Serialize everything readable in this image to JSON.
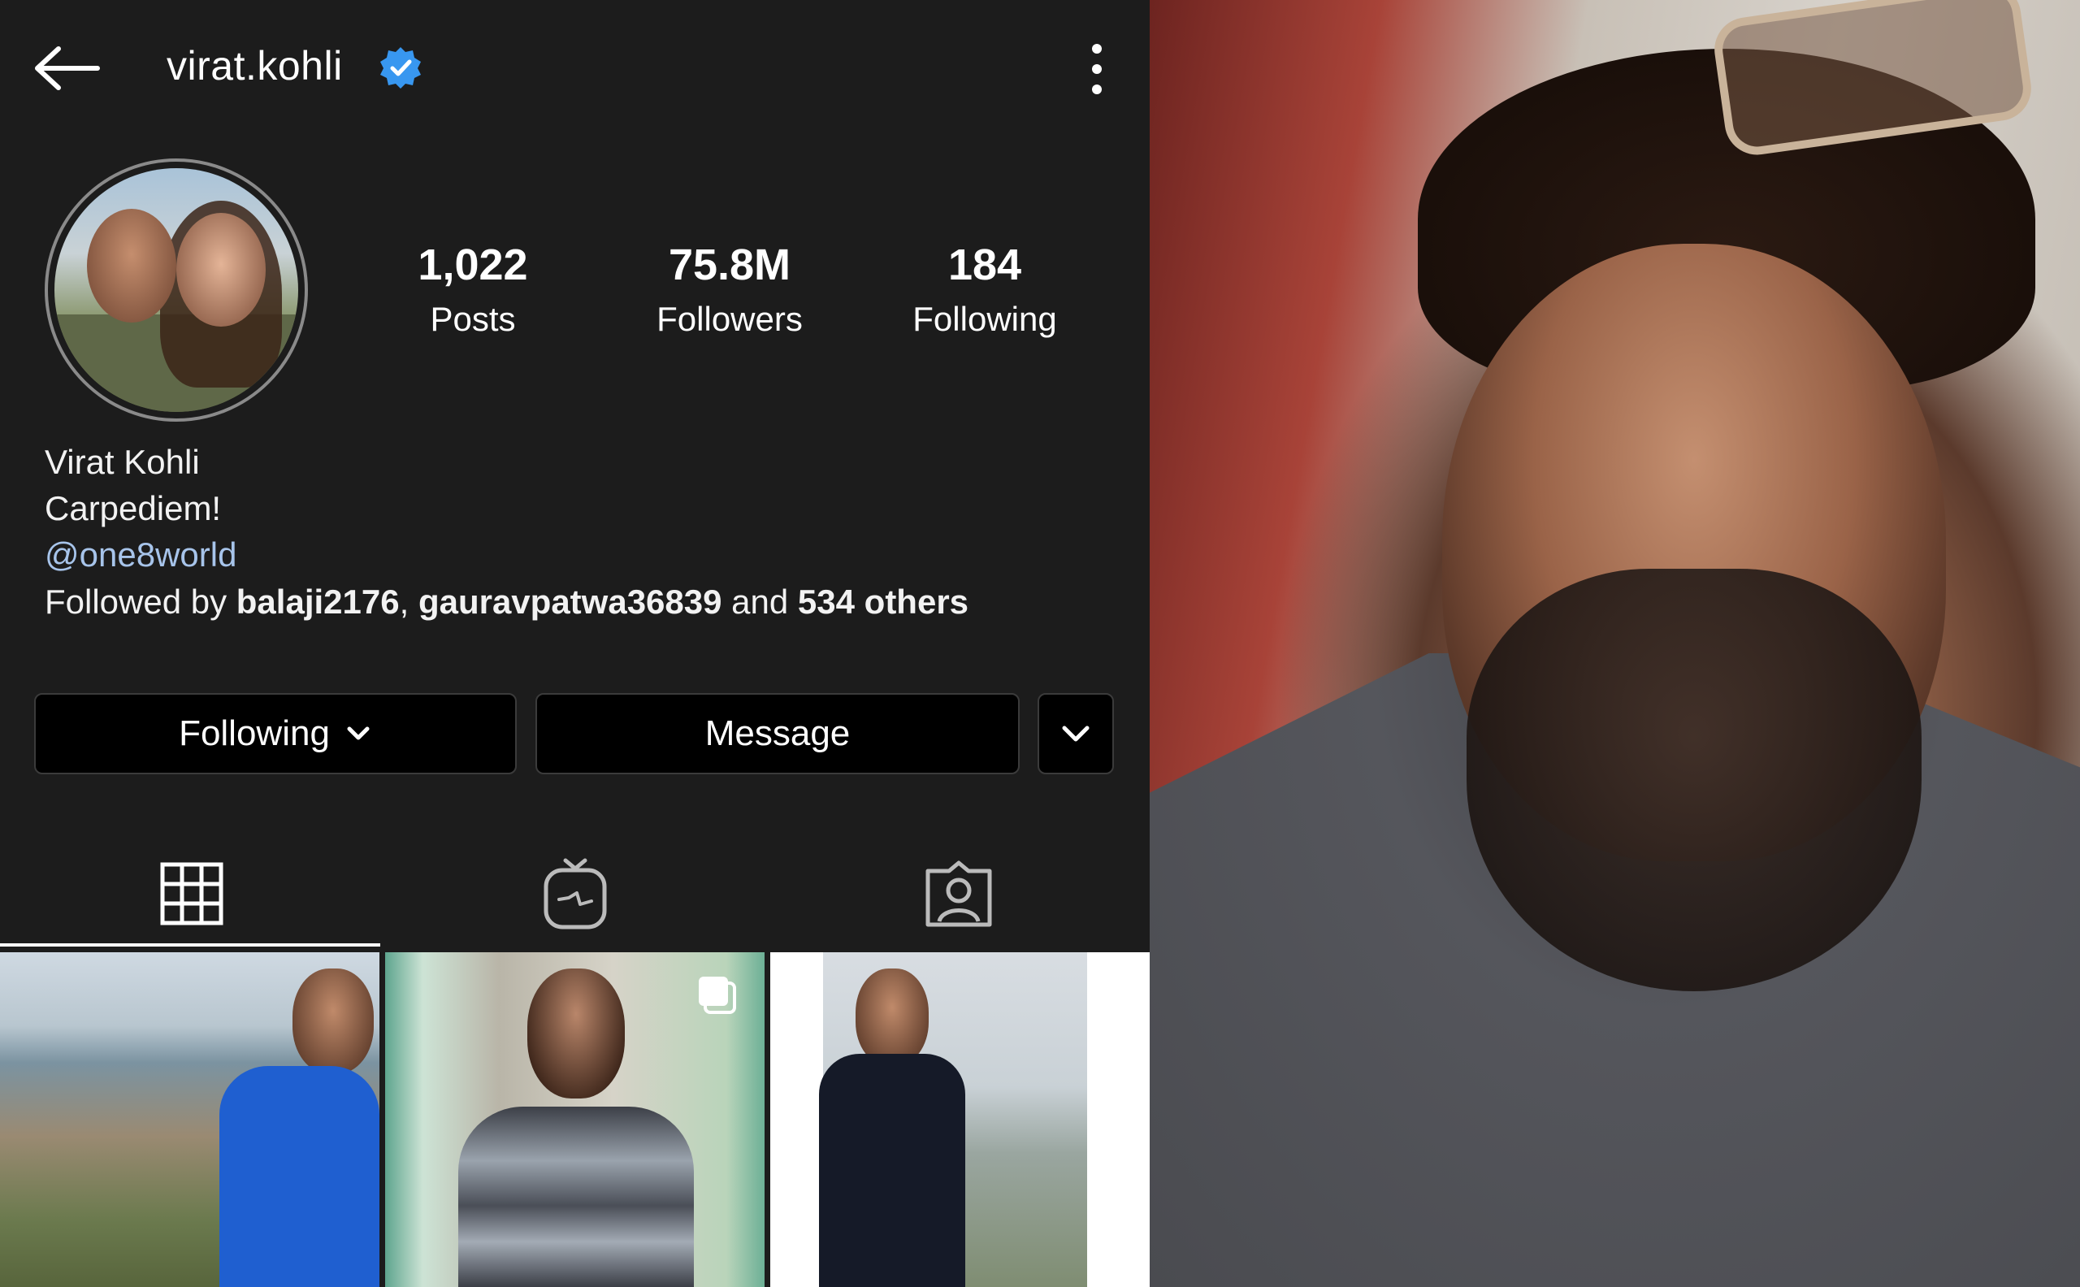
{
  "profile": {
    "username": "virat.kohli",
    "stats": [
      {
        "value": "1,022",
        "label": "Posts"
      },
      {
        "value": "75.8M",
        "label": "Followers"
      },
      {
        "value": "184",
        "label": "Following"
      }
    ],
    "name": "Virat Kohli",
    "bio": "Carpediem!",
    "link": "@one8world",
    "followed_by": {
      "prefix": "Followed by",
      "user1": "balaji2176",
      "sep": ",",
      "user2": "gauravpatwa36839",
      "and": "and",
      "others": "534 others"
    }
  },
  "buttons": {
    "following": "Following",
    "message": "Message"
  },
  "icons": {
    "back": "back-arrow-icon",
    "verified": "verified-badge-icon",
    "more": "more-vertical-icon",
    "grid": "grid-icon",
    "igtv": "igtv-icon",
    "tagged": "tagged-person-icon"
  },
  "colors": {
    "background": "#1c1c1c",
    "verified": "#3897f0",
    "link": "#a7c4ea"
  }
}
